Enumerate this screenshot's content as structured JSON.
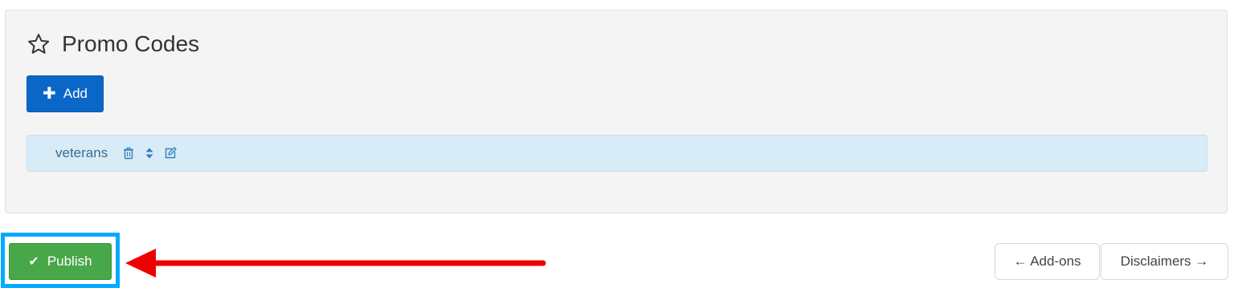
{
  "panel": {
    "title": "Promo Codes",
    "title_icon": "star-outline-icon",
    "add_button": {
      "label": "Add",
      "icon": "plus-icon",
      "color": "#0a67c8"
    },
    "promo_codes": [
      {
        "code": "veterans",
        "actions": [
          "trash-icon",
          "sort-icon",
          "edit-icon"
        ]
      }
    ]
  },
  "footer": {
    "publish_button": {
      "label": "Publish",
      "icon": "check-icon",
      "color": "#48a748"
    },
    "highlight_color": "#00aaff",
    "arrow_color": "#ee0000",
    "prev_button": {
      "label": "← Add-ons"
    },
    "next_button": {
      "label": "Disclaimers →"
    }
  }
}
